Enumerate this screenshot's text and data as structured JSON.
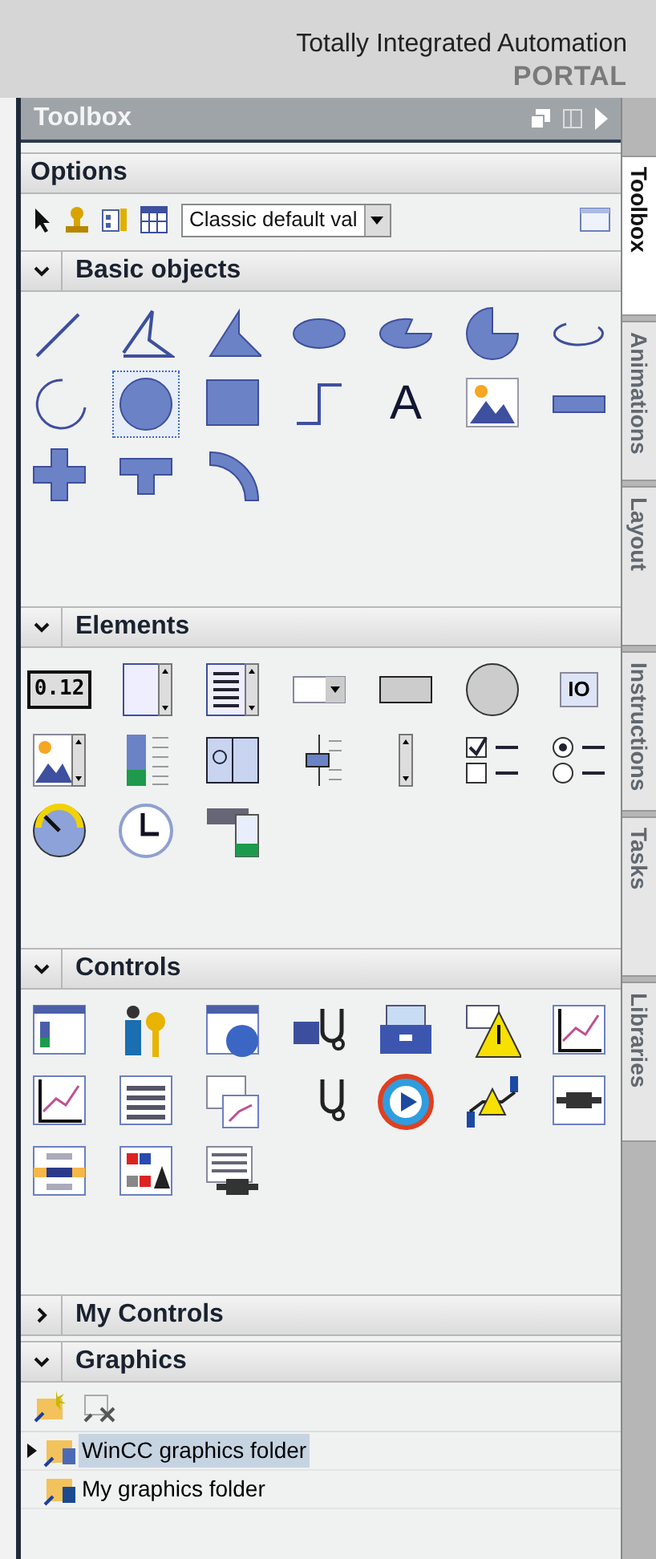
{
  "header": {
    "title": "Totally Integrated Automation",
    "subtitle": "PORTAL"
  },
  "toolbox": {
    "title": "Toolbox"
  },
  "options": {
    "title": "Options",
    "dropdown": {
      "value": "Classic default val"
    }
  },
  "sections": [
    {
      "kind": "basic",
      "title": "Basic objects",
      "expanded": true,
      "tools": [
        {
          "selected": false
        },
        {
          "selected": false
        },
        {
          "selected": false
        },
        {
          "selected": false
        },
        {
          "selected": false
        },
        {
          "selected": false
        },
        {
          "selected": false
        },
        {
          "selected": false
        },
        {
          "selected": true
        },
        {
          "selected": false
        },
        {
          "selected": false
        },
        {
          "glyph": "A",
          "selected": false
        },
        {
          "selected": false
        },
        {
          "selected": false
        },
        {
          "selected": false
        },
        {
          "selected": false
        },
        {
          "selected": false
        }
      ]
    },
    {
      "kind": "elements",
      "title": "Elements",
      "expanded": true,
      "tools": [
        {
          "glyph": "0.12",
          "selected": false
        },
        {
          "selected": false
        },
        {
          "selected": false
        },
        {
          "selected": false
        },
        {
          "selected": false
        },
        {
          "selected": false
        },
        {
          "glyph": "IO",
          "selected": false
        },
        {
          "selected": false
        },
        {
          "selected": false
        },
        {
          "selected": false
        },
        {
          "selected": false
        },
        {
          "selected": false
        },
        {
          "selected": false
        },
        {
          "selected": false
        },
        {
          "selected": false
        },
        {
          "selected": false
        },
        {
          "selected": false
        }
      ]
    },
    {
      "kind": "controls",
      "title": "Controls",
      "expanded": true,
      "tools": [
        {
          "selected": false
        },
        {
          "selected": false
        },
        {
          "selected": false
        },
        {
          "selected": false
        },
        {
          "selected": false
        },
        {
          "selected": false
        },
        {
          "selected": false
        },
        {
          "selected": false
        },
        {
          "selected": false
        },
        {
          "selected": false
        },
        {
          "selected": false
        },
        {
          "selected": false
        },
        {
          "selected": false
        },
        {
          "selected": false
        },
        {
          "selected": false
        },
        {
          "selected": false
        },
        {
          "selected": false
        }
      ]
    },
    {
      "kind": "empty",
      "title": "My Controls",
      "expanded": false
    },
    {
      "kind": "graphics",
      "title": "Graphics",
      "expanded": true,
      "folders": [
        {
          "label": "WinCC graphics folder",
          "selected": true,
          "expandable": true
        },
        {
          "label": "My graphics folder",
          "selected": false,
          "expandable": false
        }
      ]
    }
  ],
  "side_tabs": [
    {
      "label": "Toolbox",
      "selected": true
    },
    {
      "label": "Animations",
      "selected": false
    },
    {
      "label": "Layout",
      "selected": false
    },
    {
      "label": "Instructions",
      "selected": false
    },
    {
      "label": "Tasks",
      "selected": false
    },
    {
      "label": "Libraries",
      "selected": false
    }
  ]
}
